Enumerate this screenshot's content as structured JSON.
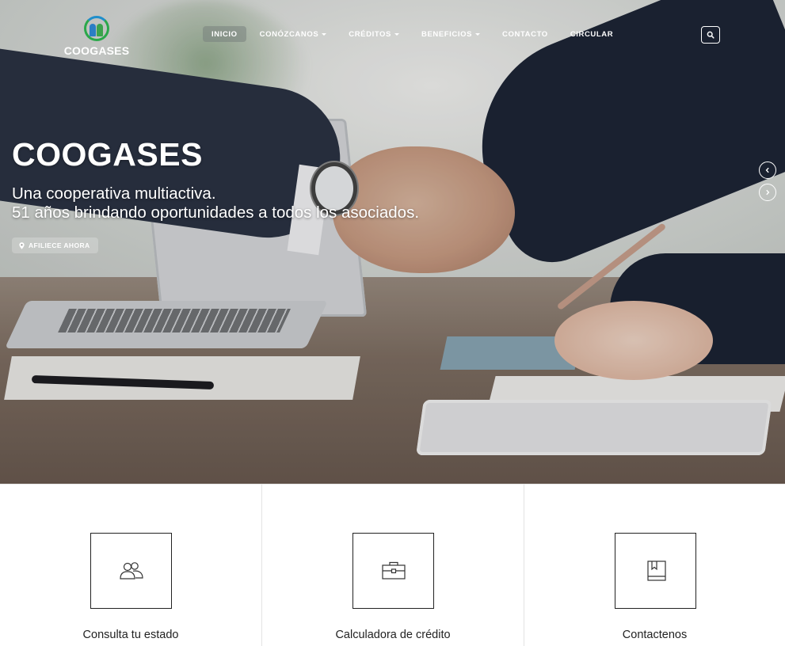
{
  "brand": {
    "name": "COOGASES"
  },
  "nav": {
    "items": [
      {
        "label": "INICIO",
        "active": true,
        "dropdown": false
      },
      {
        "label": "CONÓZCANOS",
        "active": false,
        "dropdown": true
      },
      {
        "label": "CRÉDITOS",
        "active": false,
        "dropdown": true
      },
      {
        "label": "BENEFICIOS",
        "active": false,
        "dropdown": true
      },
      {
        "label": "CONTACTO",
        "active": false,
        "dropdown": false
      },
      {
        "label": "CIRCULAR",
        "active": false,
        "dropdown": false
      }
    ],
    "search_icon": "search-icon"
  },
  "hero": {
    "title": "COOGASES",
    "subtitle_line1": "Una cooperativa multiactiva.",
    "subtitle_line2": "51 años brindando oportunidades a todos los asociados.",
    "cta_label": "AFILIECE AHORA",
    "cta_icon": "map-pin-icon"
  },
  "features": [
    {
      "label": "Consulta tu estado",
      "icon": "users-icon"
    },
    {
      "label": "Calculadora de crédito",
      "icon": "briefcase-icon"
    },
    {
      "label": "Contactenos",
      "icon": "book-icon"
    }
  ],
  "colors": {
    "logo_green": "#2aa84a",
    "logo_blue": "#1f8ecb",
    "text_dark": "#222222"
  }
}
